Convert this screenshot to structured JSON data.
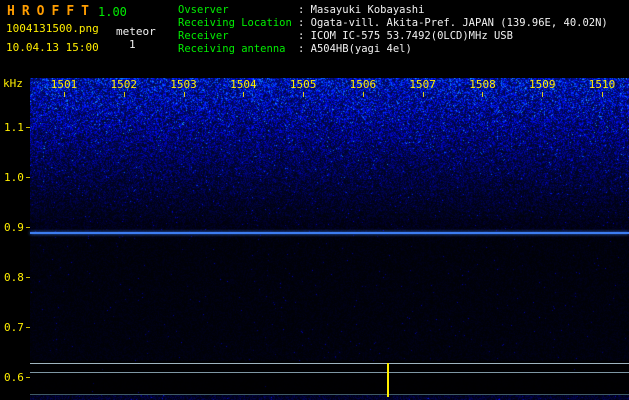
{
  "app": {
    "title_letters": [
      "H",
      "R",
      "O",
      "F",
      "F",
      "T"
    ],
    "version": "1.00",
    "filename": "1004131500.png",
    "mode": "meteor",
    "meteor_count": "1",
    "datetime": "10.04.13 15:00"
  },
  "info": {
    "separator": ":",
    "rows": [
      {
        "label": "Ovserver",
        "value": "Masayuki Kobayashi"
      },
      {
        "label": "Receiving Location",
        "value": "Ogata-vill. Akita-Pref. JAPAN (139.96E, 40.02N)"
      },
      {
        "label": "Receiver",
        "value": "ICOM IC-575 53.7492(0LCD)MHz USB"
      },
      {
        "label": "Receiving antenna",
        "value": "A504HB(yagi 4el)"
      }
    ]
  },
  "chart_data": {
    "type": "heatmap",
    "x_axis": "time (HHMM)",
    "x_ticks": [
      "1501",
      "1502",
      "1503",
      "1504",
      "1505",
      "1506",
      "1507",
      "1508",
      "1509",
      "1510"
    ],
    "y_unit": "kHz",
    "y_ticks": [
      "1.1",
      "1.0",
      "0.9",
      "0.8",
      "0.7",
      "0.6"
    ],
    "y_range_khz": [
      0.6,
      1.2
    ],
    "carrier_line_khz": 0.89,
    "marker_minute": 1506.4,
    "colors": {
      "label_green": "#00ee00",
      "text_white": "#f2f2f2",
      "accent_yellow": "#ffee00",
      "logo_orange": "#ff9d00",
      "carrier_blue": "#3d7df0",
      "trace_light": "#9fb4c0",
      "trace_mid": "#7e97a4",
      "trace_dim": "#3f5a66",
      "noise_blue": "#2233ff",
      "background": "#000000"
    }
  }
}
